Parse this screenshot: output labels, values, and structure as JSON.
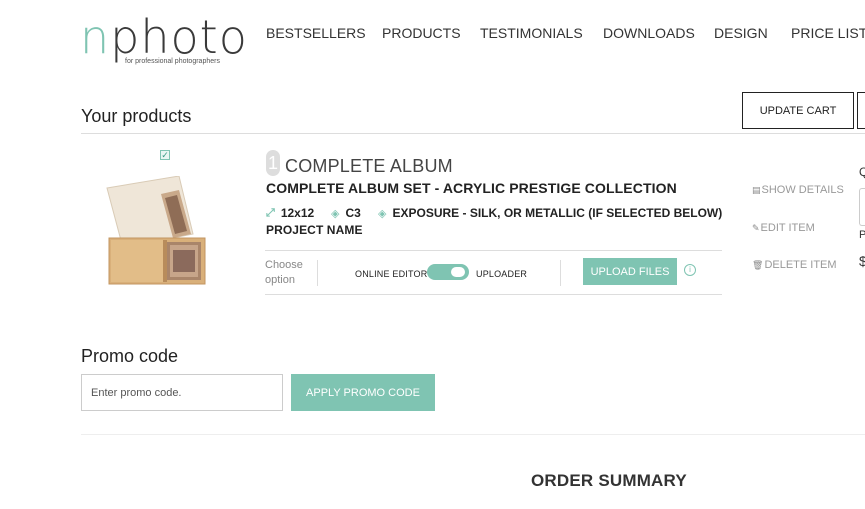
{
  "logo": {
    "word_start": "n",
    "word_rest": "photo",
    "tagline": "for professional photographers"
  },
  "nav": {
    "items": [
      "BESTSELLERS",
      "PRODUCTS",
      "TESTIMONIALS",
      "DOWNLOADS",
      "DESIGN",
      "PRICE LIST"
    ]
  },
  "products": {
    "title": "Your products",
    "update_cart_label": "UPDATE CART"
  },
  "item": {
    "number": "1",
    "title": "COMPLETE ALBUM",
    "subtitle": "COMPLETE ALBUM SET - ACRYLIC PRESTIGE COLLECTION",
    "specs": {
      "size": "12x12",
      "cover": "C3",
      "exposure": "EXPOSURE - SILK, OR METALLIC (IF SELECTED BELOW)"
    },
    "project_name": "PROJECT NAME",
    "choose_option": [
      "Choose",
      "option"
    ],
    "online_editor_label": "ONLINE EDITOR",
    "uploader_label": "UPLOADER",
    "upload_button": "UPLOAD FILES",
    "actions": {
      "show_details": "SHOW DETAILS",
      "edit_item": "EDIT ITEM",
      "delete_item": "DELETE ITEM"
    },
    "selected": true
  },
  "right_cut": {
    "q": "Q",
    "p": "P",
    "dollar": "$"
  },
  "promo": {
    "title": "Promo code",
    "placeholder": "Enter promo code.",
    "apply_label": "APPLY PROMO CODE"
  },
  "order_summary": {
    "title": "ORDER SUMMARY"
  },
  "colors": {
    "accent": "#7fc4b2",
    "text": "#222222",
    "divider": "#dddddd"
  }
}
